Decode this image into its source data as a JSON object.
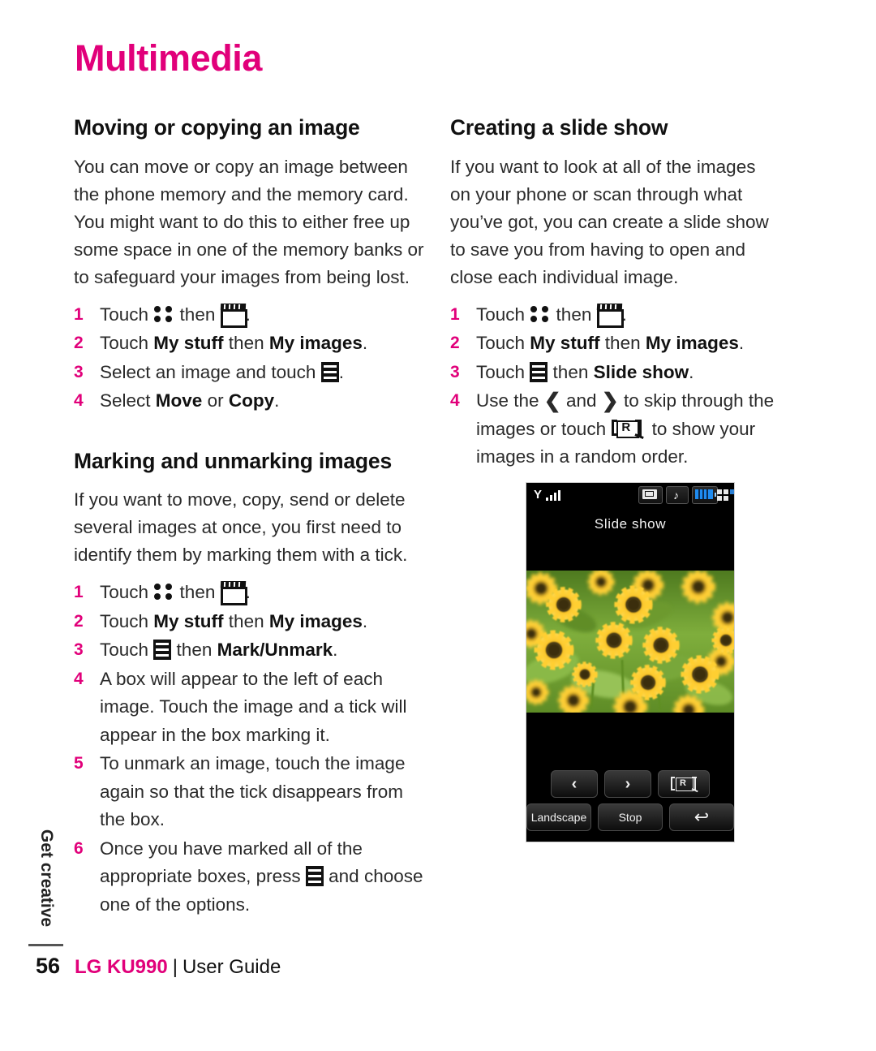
{
  "page": {
    "chapter_title": "Multimedia",
    "page_number": "56",
    "side_tab": "Get creative",
    "footer": {
      "brand": "LG KU990",
      "separator": "|",
      "guide": "User Guide"
    },
    "accent_color": "#e1007a"
  },
  "left_column": {
    "section1": {
      "heading": "Moving or copying an image",
      "paragraph": "You can move or copy an image between the phone memory and the memory card. You might want to do this to either free up some space in one of the memory banks or to safeguard your images from being lost.",
      "steps": [
        {
          "num": "1",
          "pre": "Touch ",
          "mid": " then ",
          "post": "."
        },
        {
          "num": "2",
          "pre": "Touch ",
          "b1": "My stuff",
          "mid": " then ",
          "b2": "My images",
          "post": "."
        },
        {
          "num": "3",
          "pre": "Select an image and touch ",
          "post": "."
        },
        {
          "num": "4",
          "pre": "Select ",
          "b1": "Move",
          "mid": " or ",
          "b2": "Copy",
          "post": "."
        }
      ]
    },
    "section2": {
      "heading": "Marking and unmarking images",
      "paragraph": "If you want to move, copy, send or delete several images at once, you first need to identify them by marking them with a tick.",
      "steps": [
        {
          "num": "1",
          "pre": "Touch ",
          "mid": " then ",
          "post": "."
        },
        {
          "num": "2",
          "pre": "Touch ",
          "b1": "My stuff",
          "mid": " then ",
          "b2": "My images",
          "post": "."
        },
        {
          "num": "3",
          "pre": "Touch ",
          "mid": " then ",
          "b2": "Mark/Unmark",
          "post": "."
        },
        {
          "num": "4",
          "pre": "A box will appear to the left of each image. Touch the image and a tick will appear in the box marking it."
        },
        {
          "num": "5",
          "pre": "To unmark an image, touch the image again so that the tick disappears from the box."
        },
        {
          "num": "6",
          "pre": "Once you have marked all of the appropriate boxes, press ",
          "post": " and choose one of the options."
        }
      ]
    }
  },
  "right_column": {
    "section1": {
      "heading": "Creating a slide show",
      "paragraph": "If you want to look at all of the images on your phone or scan through what you’ve got, you can create a slide show to save you from having to open and close each individual image.",
      "steps": [
        {
          "num": "1",
          "pre": "Touch ",
          "mid": " then ",
          "post": "."
        },
        {
          "num": "2",
          "pre": "Touch ",
          "b1": "My stuff",
          "mid": " then ",
          "b2": "My images",
          "post": "."
        },
        {
          "num": "3",
          "pre": "Touch ",
          "mid": " then ",
          "b2": "Slide show",
          "post": "."
        },
        {
          "num": "4",
          "pre": "Use the ",
          "mid": " and ",
          "mid2": " to skip through the images or touch ",
          "post": " to show your images in a random order."
        }
      ]
    }
  },
  "phone_screenshot": {
    "title": "Slide show",
    "status_icons": [
      "signal-icon",
      "message-icon",
      "sound-icon",
      "battery-icon",
      "menu-grid-icon"
    ],
    "photo_description": "field of sunflowers",
    "buttons_row1": [
      {
        "name": "previous-button",
        "label": "‹"
      },
      {
        "name": "next-button",
        "label": "›"
      },
      {
        "name": "random-button",
        "label": "R"
      }
    ],
    "buttons_row2": [
      {
        "name": "landscape-button",
        "label": "Landscape"
      },
      {
        "name": "stop-button",
        "label": "Stop"
      },
      {
        "name": "back-button",
        "label": "↩"
      }
    ]
  },
  "icons": {
    "dots": "main-menu-dots-icon",
    "clapper": "multimedia-clapperboard-icon",
    "options": "options-list-icon",
    "chev_left": "❮",
    "chev_right": "❯",
    "random": "random-r-icon"
  }
}
